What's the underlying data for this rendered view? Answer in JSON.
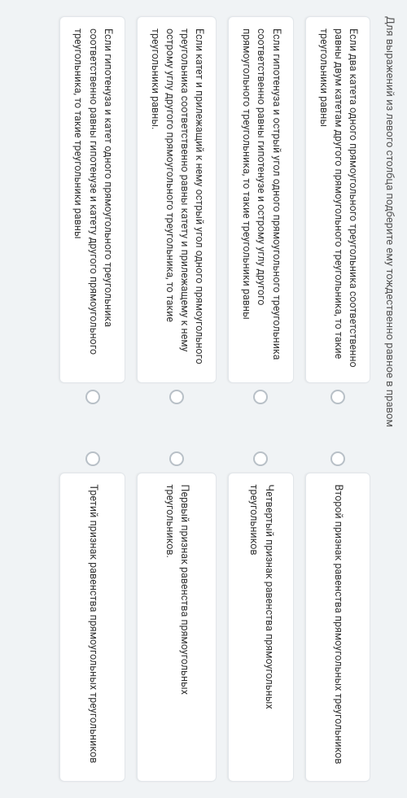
{
  "instruction": "Для выражений из левого столбца подберите ему тождественно равное в правом",
  "rows": [
    {
      "left": "Если два катета одного прямоугольного треугольника соответственно равны двум катетам другого прямоугольного треугольника, то такие треугольники равны",
      "right": "Второй признак равенства прямоугольных треугольников"
    },
    {
      "left": "Если гипотенуза и острый угол одного прямоугольного треугольника соответственно равны гипотенузе и острому углу другого прямоугольного треугольника, то такие треугольники равны",
      "right": "Четвертый признак равенства прямоугольных треугольников"
    },
    {
      "left": "Если катет и прилежащий к нему острый угол одного прямоугольного треугольника соответственно равны катету и прилежащему к нему острому углу другого прямоугольного треугольника, то такие треугольники равны.",
      "right": "Первый признак равенства прямоугольных треугольников."
    },
    {
      "left": "Если гипотенуза и катет одного прямоугольного треугольника соответственно равны гипотенузе и катету другого прямоугольного треугольника, то такие треугольники равны",
      "right": "Третий признак равенства прямоугольных треугольников"
    }
  ]
}
